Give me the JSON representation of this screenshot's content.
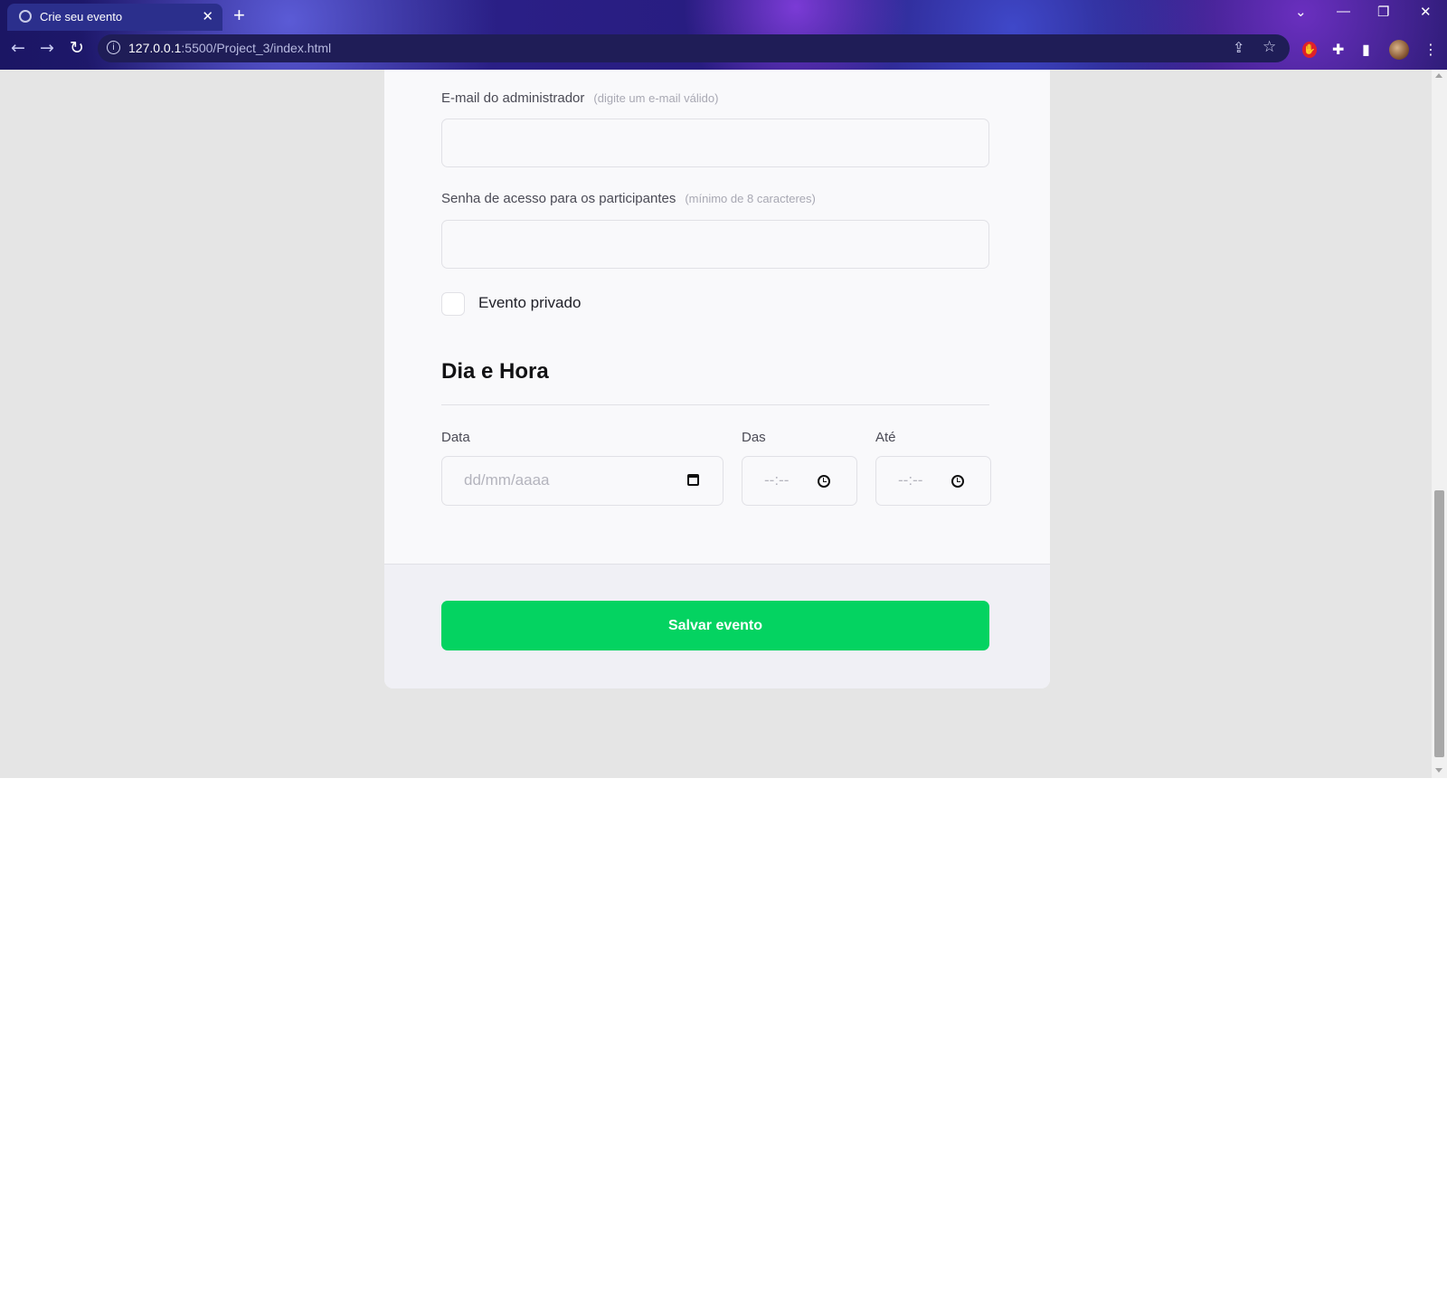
{
  "browser": {
    "tab_title": "Crie seu evento",
    "url_host": "127.0.0.1",
    "url_path": ":5500/Project_3/index.html"
  },
  "form": {
    "email_label": "E-mail do administrador",
    "email_hint": "(digite um e-mail válido)",
    "password_label": "Senha de acesso para os participantes",
    "password_hint": "(mínimo de 8 caracteres)",
    "private_label": "Evento privado",
    "section_title": "Dia e Hora",
    "date_label": "Data",
    "date_placeholder": "dd/mm/aaaa",
    "from_label": "Das",
    "to_label": "Até",
    "time_placeholder": "--:--",
    "save_button": "Salvar evento"
  },
  "colors": {
    "accent": "#04d361",
    "page_bg": "#e5e5e5"
  }
}
